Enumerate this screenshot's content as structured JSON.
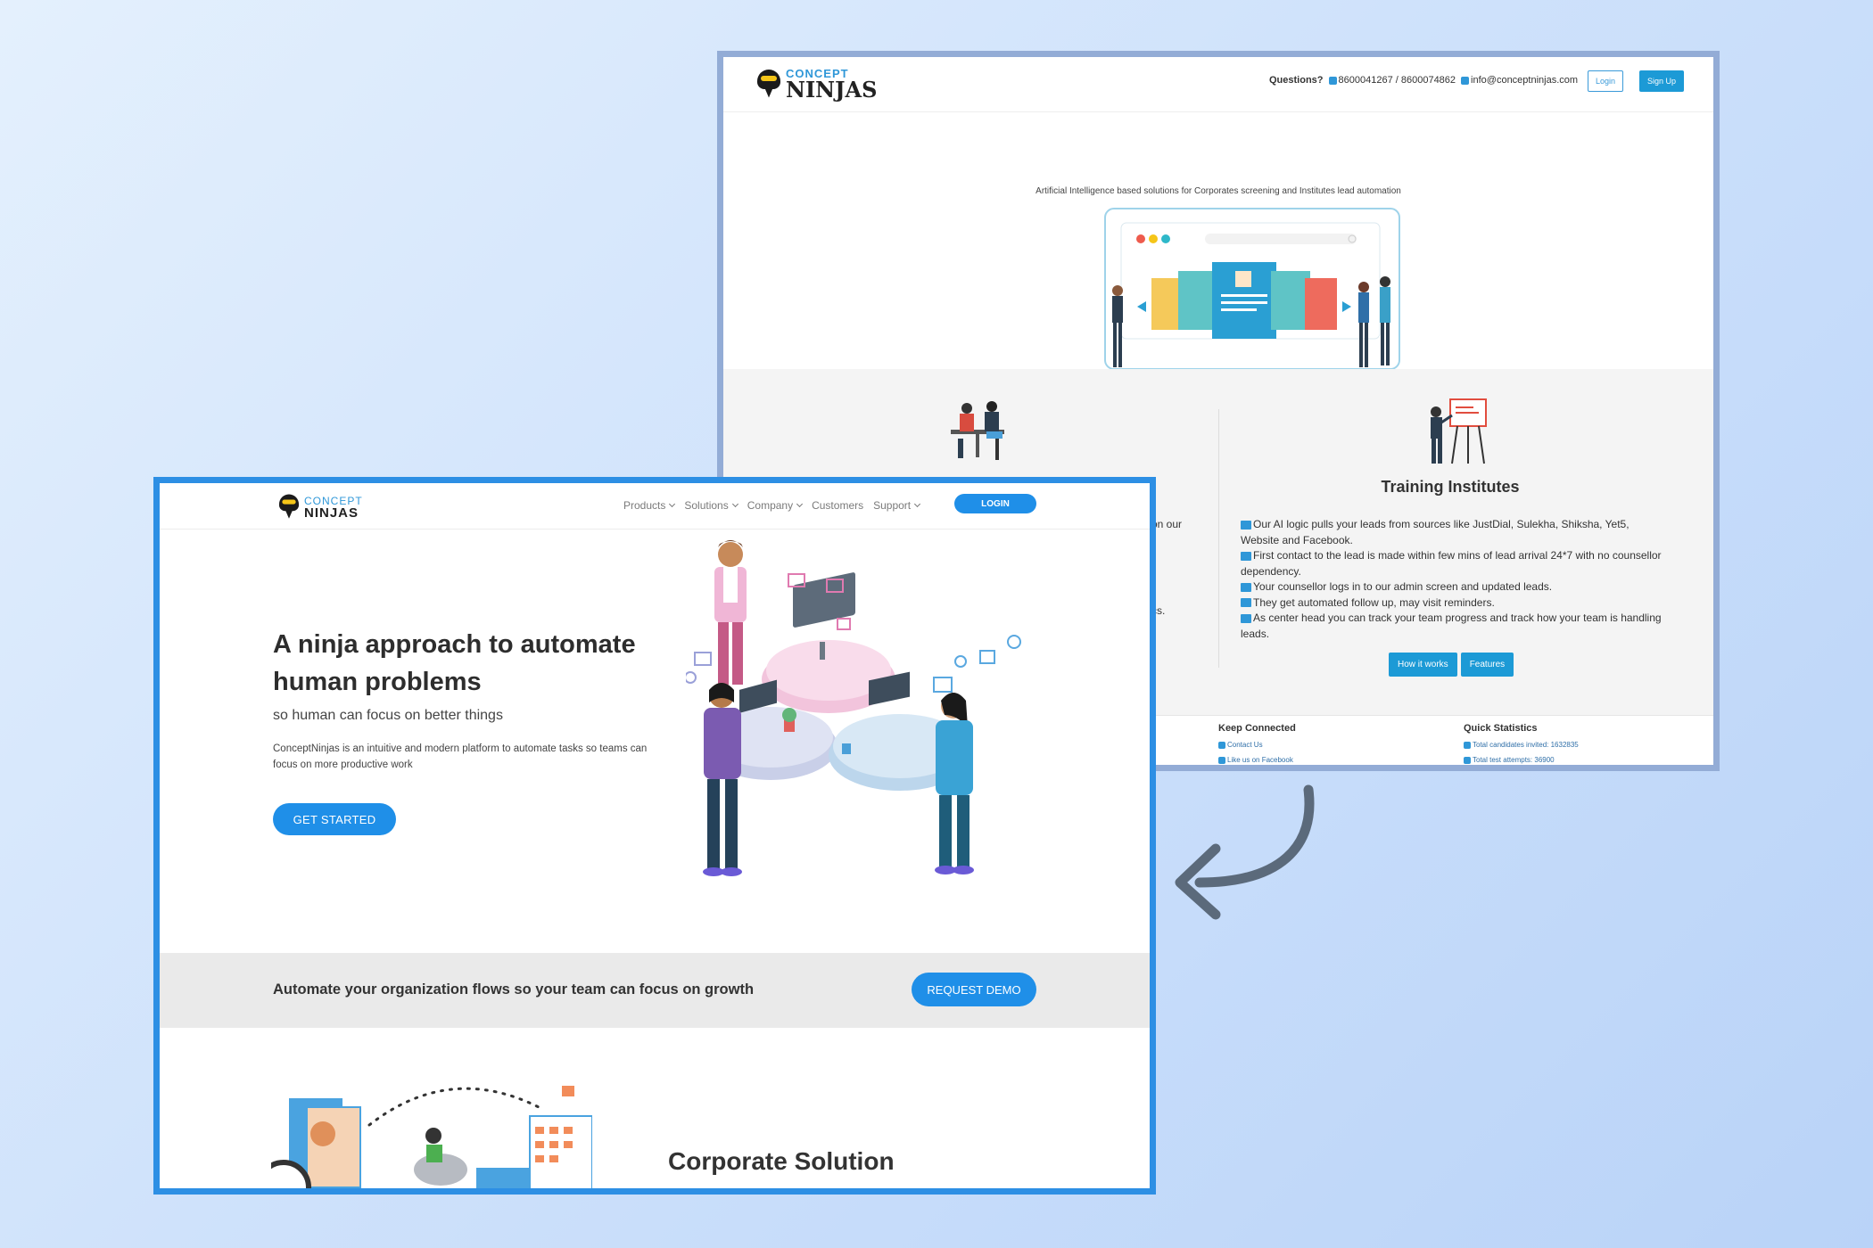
{
  "old_site": {
    "logo": {
      "top": "CONCEPT",
      "bottom": "NINJAS"
    },
    "header": {
      "questions_label": "Questions?",
      "phones": "8600041267 / 8600074862",
      "email": "info@conceptninjas.com",
      "login_label": "Login",
      "signup_label": "Sign Up"
    },
    "tagline": "Artificial Intelligence based solutions for Corporates screening and Institutes lead automation",
    "partial_left_1": "on our",
    "partial_left_2": "cs.",
    "training": {
      "title": "Training Institutes",
      "items": [
        "Our AI logic pulls your leads from sources like JustDial, Sulekha, Shiksha, Yet5, Website and Facebook.",
        "First contact to the lead is made within few mins of lead arrival 24*7 with no counsellor dependency.",
        "Your counsellor logs in to our admin screen and updated leads.",
        "They get automated follow up, may visit reminders.",
        "As center head you can track your team progress and track how your team is handling leads."
      ],
      "how_label": "How it works",
      "features_label": "Features"
    },
    "footer": {
      "keep_connected": "Keep Connected",
      "contact_us": "Contact Us",
      "like_fb": "Like us on Facebook",
      "quick_stats": "Quick Statistics",
      "stat1": "Total candidates invited: 1632835",
      "stat2": "Total test attempts: 36900"
    }
  },
  "new_site": {
    "logo": {
      "top": "CONCEPT",
      "bottom": "NINJAS"
    },
    "nav": {
      "products": "Products",
      "solutions": "Solutions",
      "company": "Company",
      "customers": "Customers",
      "support": "Support",
      "login": "LOGIN"
    },
    "hero": {
      "title": "A ninja approach to automate human problems",
      "subtitle": "so human can focus on better things",
      "description": "ConceptNinjas is an intuitive and modern platform to automate tasks so teams can focus on more productive work",
      "cta": "GET STARTED"
    },
    "demo": {
      "text": "Automate your organization flows so your team can focus on growth",
      "cta": "REQUEST DEMO"
    },
    "corporate_title": "Corporate Solution"
  },
  "colors": {
    "accent": "#1f8fe8",
    "old_frame": "#93acd6",
    "new_frame": "#2d8fe4",
    "arrow": "#5b6a7b"
  }
}
